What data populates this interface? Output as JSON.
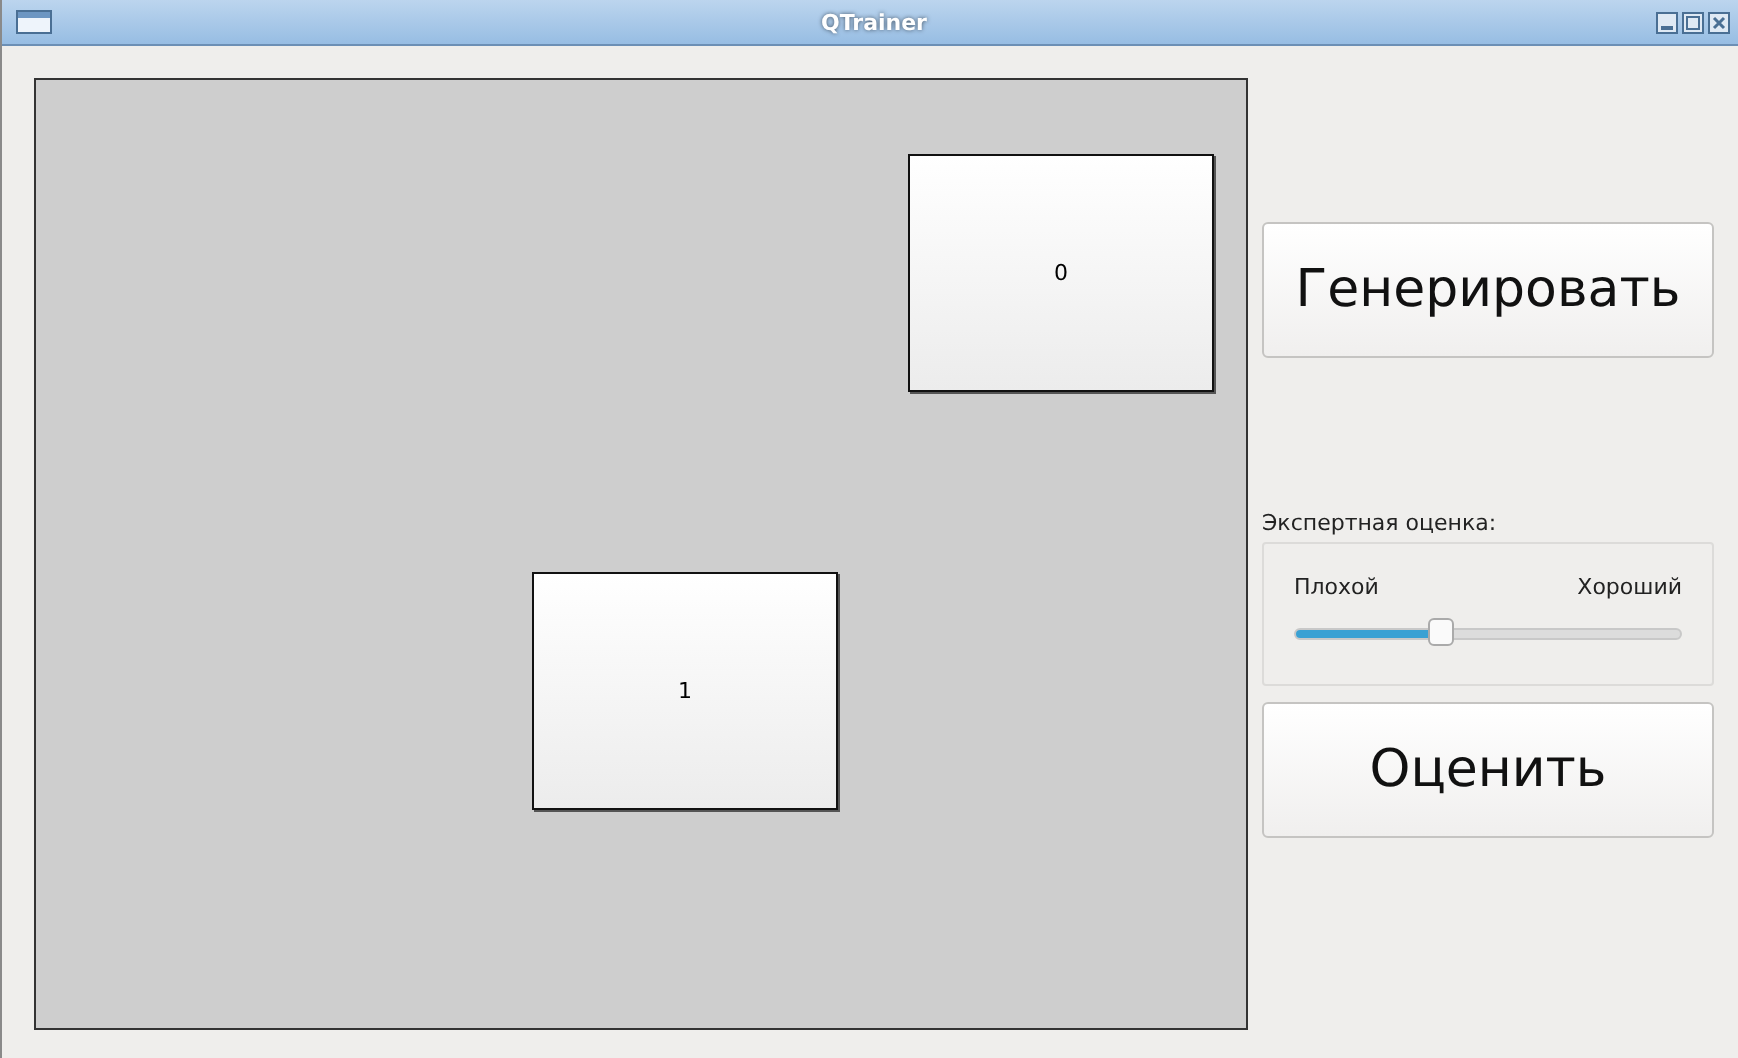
{
  "window": {
    "title": "QTrainer"
  },
  "canvas": {
    "cards": [
      {
        "label": "0"
      },
      {
        "label": "1"
      }
    ]
  },
  "generate_button": {
    "label": "Генерировать"
  },
  "rating": {
    "title": "Экспертная оценка:",
    "min_label": "Плохой",
    "max_label": "Хороший",
    "level": 0.38
  },
  "rate_button": {
    "label": "Оценить"
  }
}
